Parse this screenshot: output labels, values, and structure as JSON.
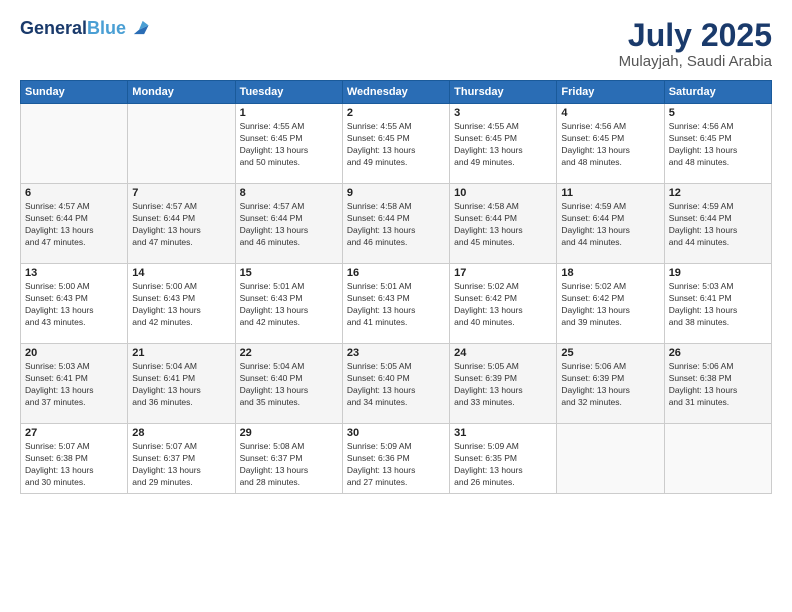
{
  "header": {
    "logo_line1": "General",
    "logo_line2": "Blue",
    "month": "July 2025",
    "location": "Mulayjah, Saudi Arabia"
  },
  "weekdays": [
    "Sunday",
    "Monday",
    "Tuesday",
    "Wednesday",
    "Thursday",
    "Friday",
    "Saturday"
  ],
  "weeks": [
    [
      {
        "day": "",
        "info": ""
      },
      {
        "day": "",
        "info": ""
      },
      {
        "day": "1",
        "info": "Sunrise: 4:55 AM\nSunset: 6:45 PM\nDaylight: 13 hours\nand 50 minutes."
      },
      {
        "day": "2",
        "info": "Sunrise: 4:55 AM\nSunset: 6:45 PM\nDaylight: 13 hours\nand 49 minutes."
      },
      {
        "day": "3",
        "info": "Sunrise: 4:55 AM\nSunset: 6:45 PM\nDaylight: 13 hours\nand 49 minutes."
      },
      {
        "day": "4",
        "info": "Sunrise: 4:56 AM\nSunset: 6:45 PM\nDaylight: 13 hours\nand 48 minutes."
      },
      {
        "day": "5",
        "info": "Sunrise: 4:56 AM\nSunset: 6:45 PM\nDaylight: 13 hours\nand 48 minutes."
      }
    ],
    [
      {
        "day": "6",
        "info": "Sunrise: 4:57 AM\nSunset: 6:44 PM\nDaylight: 13 hours\nand 47 minutes."
      },
      {
        "day": "7",
        "info": "Sunrise: 4:57 AM\nSunset: 6:44 PM\nDaylight: 13 hours\nand 47 minutes."
      },
      {
        "day": "8",
        "info": "Sunrise: 4:57 AM\nSunset: 6:44 PM\nDaylight: 13 hours\nand 46 minutes."
      },
      {
        "day": "9",
        "info": "Sunrise: 4:58 AM\nSunset: 6:44 PM\nDaylight: 13 hours\nand 46 minutes."
      },
      {
        "day": "10",
        "info": "Sunrise: 4:58 AM\nSunset: 6:44 PM\nDaylight: 13 hours\nand 45 minutes."
      },
      {
        "day": "11",
        "info": "Sunrise: 4:59 AM\nSunset: 6:44 PM\nDaylight: 13 hours\nand 44 minutes."
      },
      {
        "day": "12",
        "info": "Sunrise: 4:59 AM\nSunset: 6:44 PM\nDaylight: 13 hours\nand 44 minutes."
      }
    ],
    [
      {
        "day": "13",
        "info": "Sunrise: 5:00 AM\nSunset: 6:43 PM\nDaylight: 13 hours\nand 43 minutes."
      },
      {
        "day": "14",
        "info": "Sunrise: 5:00 AM\nSunset: 6:43 PM\nDaylight: 13 hours\nand 42 minutes."
      },
      {
        "day": "15",
        "info": "Sunrise: 5:01 AM\nSunset: 6:43 PM\nDaylight: 13 hours\nand 42 minutes."
      },
      {
        "day": "16",
        "info": "Sunrise: 5:01 AM\nSunset: 6:43 PM\nDaylight: 13 hours\nand 41 minutes."
      },
      {
        "day": "17",
        "info": "Sunrise: 5:02 AM\nSunset: 6:42 PM\nDaylight: 13 hours\nand 40 minutes."
      },
      {
        "day": "18",
        "info": "Sunrise: 5:02 AM\nSunset: 6:42 PM\nDaylight: 13 hours\nand 39 minutes."
      },
      {
        "day": "19",
        "info": "Sunrise: 5:03 AM\nSunset: 6:41 PM\nDaylight: 13 hours\nand 38 minutes."
      }
    ],
    [
      {
        "day": "20",
        "info": "Sunrise: 5:03 AM\nSunset: 6:41 PM\nDaylight: 13 hours\nand 37 minutes."
      },
      {
        "day": "21",
        "info": "Sunrise: 5:04 AM\nSunset: 6:41 PM\nDaylight: 13 hours\nand 36 minutes."
      },
      {
        "day": "22",
        "info": "Sunrise: 5:04 AM\nSunset: 6:40 PM\nDaylight: 13 hours\nand 35 minutes."
      },
      {
        "day": "23",
        "info": "Sunrise: 5:05 AM\nSunset: 6:40 PM\nDaylight: 13 hours\nand 34 minutes."
      },
      {
        "day": "24",
        "info": "Sunrise: 5:05 AM\nSunset: 6:39 PM\nDaylight: 13 hours\nand 33 minutes."
      },
      {
        "day": "25",
        "info": "Sunrise: 5:06 AM\nSunset: 6:39 PM\nDaylight: 13 hours\nand 32 minutes."
      },
      {
        "day": "26",
        "info": "Sunrise: 5:06 AM\nSunset: 6:38 PM\nDaylight: 13 hours\nand 31 minutes."
      }
    ],
    [
      {
        "day": "27",
        "info": "Sunrise: 5:07 AM\nSunset: 6:38 PM\nDaylight: 13 hours\nand 30 minutes."
      },
      {
        "day": "28",
        "info": "Sunrise: 5:07 AM\nSunset: 6:37 PM\nDaylight: 13 hours\nand 29 minutes."
      },
      {
        "day": "29",
        "info": "Sunrise: 5:08 AM\nSunset: 6:37 PM\nDaylight: 13 hours\nand 28 minutes."
      },
      {
        "day": "30",
        "info": "Sunrise: 5:09 AM\nSunset: 6:36 PM\nDaylight: 13 hours\nand 27 minutes."
      },
      {
        "day": "31",
        "info": "Sunrise: 5:09 AM\nSunset: 6:35 PM\nDaylight: 13 hours\nand 26 minutes."
      },
      {
        "day": "",
        "info": ""
      },
      {
        "day": "",
        "info": ""
      }
    ]
  ]
}
